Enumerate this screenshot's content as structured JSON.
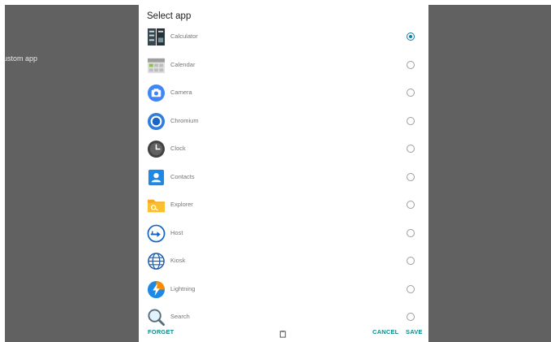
{
  "background": {
    "text": "ustom app"
  },
  "dialog": {
    "title": "Select app",
    "apps": [
      {
        "label": "Calculator",
        "icon": "calculator-icon",
        "selected": true
      },
      {
        "label": "Calendar",
        "icon": "calendar-icon",
        "selected": false
      },
      {
        "label": "Camera",
        "icon": "camera-icon",
        "selected": false
      },
      {
        "label": "Chromium",
        "icon": "chromium-icon",
        "selected": false
      },
      {
        "label": "Clock",
        "icon": "clock-icon",
        "selected": false
      },
      {
        "label": "Contacts",
        "icon": "contacts-icon",
        "selected": false
      },
      {
        "label": "Explorer",
        "icon": "explorer-icon",
        "selected": false
      },
      {
        "label": "Host",
        "icon": "host-icon",
        "selected": false
      },
      {
        "label": "Kiosk",
        "icon": "kiosk-icon",
        "selected": false
      },
      {
        "label": "Lightning",
        "icon": "lightning-icon",
        "selected": false
      },
      {
        "label": "Search",
        "icon": "search-icon",
        "selected": false
      }
    ],
    "footer": {
      "forget_label": "FORGET",
      "cancel_label": "CANCEL",
      "save_label": "SAVE",
      "center_icon": "clipboard-icon"
    }
  },
  "colors": {
    "accent": "#0d8e8a",
    "radio_selected": "#0d7ea6",
    "backdrop": "#616161"
  }
}
